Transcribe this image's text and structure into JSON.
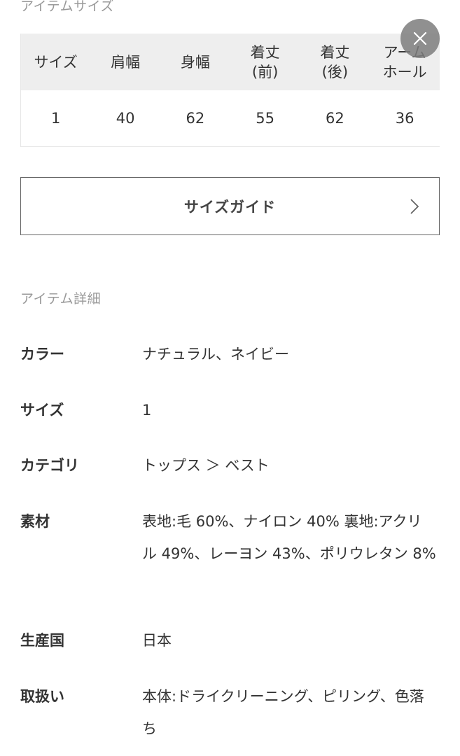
{
  "size_section": {
    "title": "アイテムサイズ",
    "headers": [
      "サイズ",
      "肩幅",
      "身幅",
      "着丈\n(前)",
      "着丈\n(後)",
      "アーム\nホール"
    ],
    "rows": [
      [
        "1",
        "40",
        "62",
        "55",
        "62",
        "36"
      ]
    ]
  },
  "close_button": {
    "icon": "close-icon"
  },
  "size_guide": {
    "label": "サイズガイド",
    "icon": "chevron-right-icon"
  },
  "details_section": {
    "title": "アイテム詳細",
    "items": [
      {
        "label": "カラー",
        "value": "ナチュラル、ネイビー"
      },
      {
        "label": "サイズ",
        "value": "1"
      },
      {
        "label": "カテゴリ",
        "value": "トップス ＞ ベスト"
      },
      {
        "label": "素材",
        "value": "表地:毛 60%、ナイロン 40% 裏地:アクリル 49%、レーヨン 43%、ポリウレタン 8%"
      },
      {
        "label": "生産国",
        "value": "日本"
      },
      {
        "label": "取扱い",
        "value": "本体:ドライクリーニング、ピリング、色落ち"
      }
    ]
  },
  "colors": {
    "header_bg": "#eeeeee",
    "muted_text": "#999999",
    "close_bg": "#7d7d7d"
  }
}
